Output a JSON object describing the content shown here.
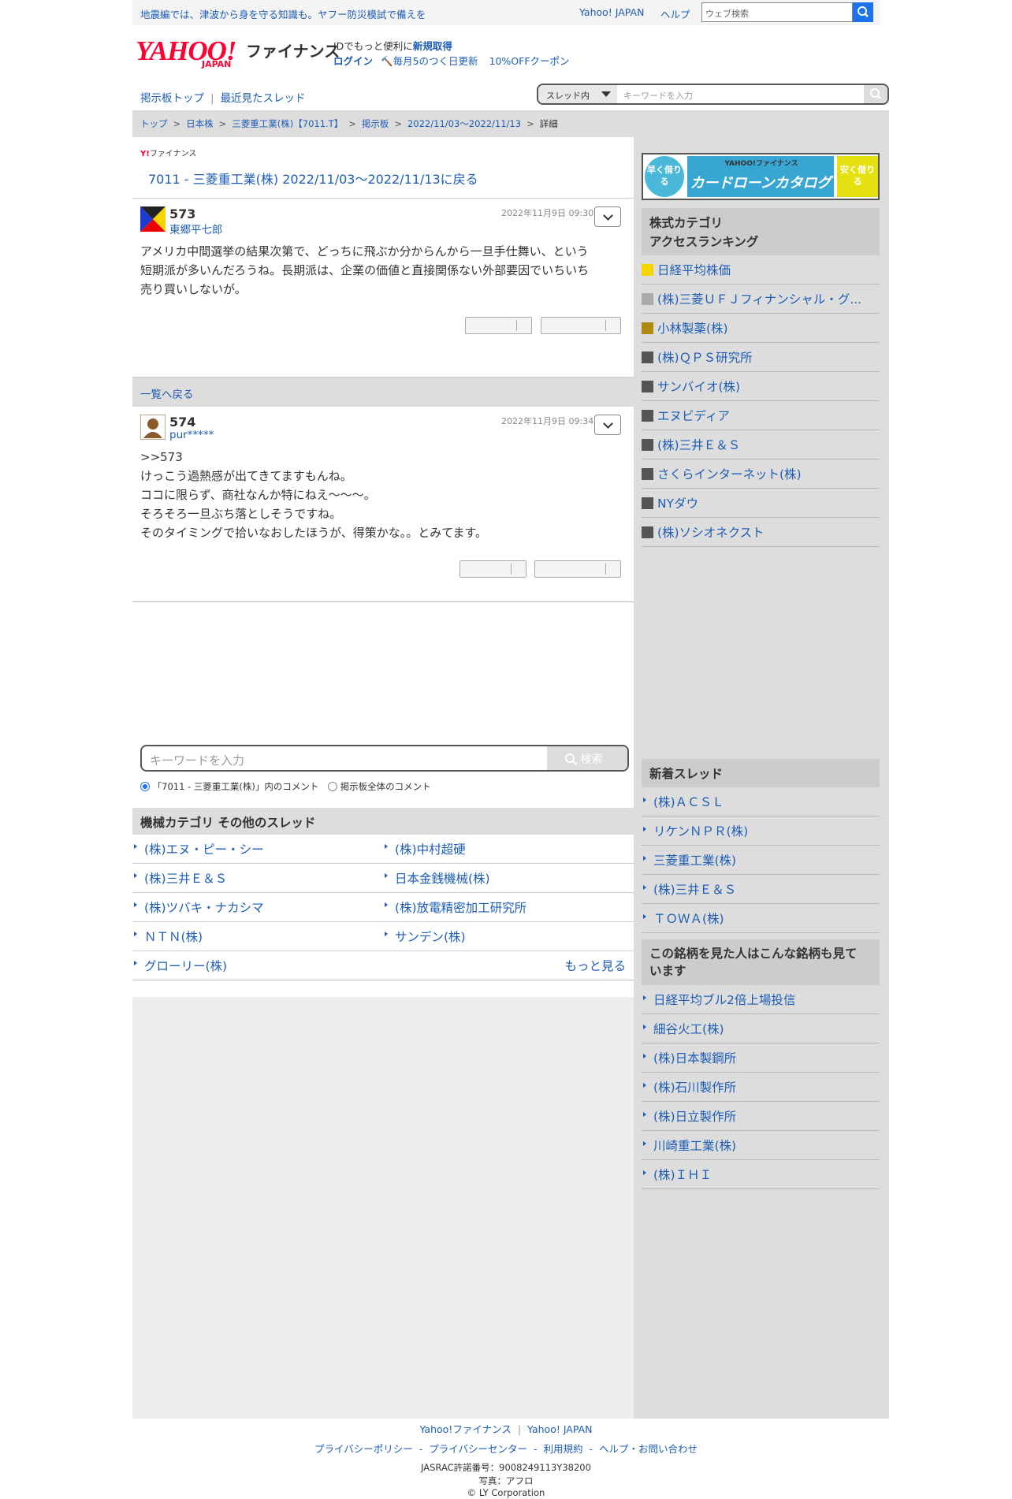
{
  "top": {
    "promo": "地震編では、津波から身を守る知識も。ヤフー防災模試で備えを",
    "link1": "Yahoo! JAPAN",
    "link2": "ヘルプ",
    "search_placeholder": "ウェブ検索"
  },
  "header": {
    "logo": "YAHOO!",
    "logo_sub": "JAPAN",
    "service": "ファイナンス",
    "line1_prefix": "IDでもっと便利に",
    "line1_link": "新規取得",
    "login": "ログイン",
    "promo1": "毎月5のつく日更新",
    "promo2": "10%OFFクーポン"
  },
  "nav": {
    "board_top": "掲示板トップ",
    "recent": "最近見たスレッド",
    "scope": "スレッド内",
    "placeholder": "キーワードを入力"
  },
  "breadcrumb": [
    "トップ",
    "日本株",
    "三菱重工業(株)【7011.T】",
    "掲示板",
    "2022/11/03〜2022/11/13",
    "詳細"
  ],
  "thread": {
    "small_logo": "ファイナンス",
    "back_title": "7011 - 三菱重工業(株) 2022/11/03〜2022/11/13に戻る",
    "list_back": "一覧へ戻る"
  },
  "posts": [
    {
      "num": "573",
      "user": "東郷平七郎",
      "date": "2022年11月9日 09:30",
      "lines": [
        "アメリカ中間選挙の結果次第で、どっちに飛ぶか分からんから一旦手仕舞い、という",
        "短期派が多いんだろうね。長期派は、企業の価値と直接関係ない外部要因でいちいち",
        "売り買いしないが。"
      ]
    },
    {
      "num": "574",
      "user": "pur*****",
      "date": "2022年11月9日 09:34",
      "lines": [
        ">>573",
        "けっこう過熱感が出てきてますもんね。",
        "ココに限らず、商社なんか特にねえ〜〜〜。",
        "そろそろ一旦ぶち落としそうですね。",
        "そのタイミングで拾いなおしたほうが、得策かな。。とみてます。"
      ]
    }
  ],
  "search": {
    "placeholder": "キーワードを入力",
    "button": "検索",
    "radio1": "「7011 - 三菱重工業(株)」内のコメント",
    "radio2": "掲示板全体のコメント"
  },
  "other": {
    "heading": "機械カテゴリ その他のスレッド",
    "items": [
      "(株)エヌ・ピー・シー",
      "(株)中村超硬",
      "(株)三井Ｅ＆Ｓ",
      "日本金銭機械(株)",
      "(株)ツバキ・ナカシマ",
      "(株)放電精密加工研究所",
      "ＮＴＮ(株)",
      "サンデン(株)",
      "グローリー(株)"
    ],
    "more": "もっと見る"
  },
  "ad": {
    "text": "カードローンカタログ",
    "left": "早く借りる",
    "right": "安く借りる",
    "brand": "YAHOO!ファイナンス"
  },
  "ranking": {
    "heading1": "株式カテゴリ",
    "heading2": "アクセスランキング",
    "items": [
      {
        "name": "日経平均株価",
        "color": "#f5d400"
      },
      {
        "name": "(株)三菱ＵＦＪフィナンシャル・グ...",
        "color": "#aaaaaa"
      },
      {
        "name": "小林製薬(株)",
        "color": "#b08a10"
      },
      {
        "name": "(株)ＱＰＳ研究所",
        "color": "#555555"
      },
      {
        "name": "サンバイオ(株)",
        "color": "#555555"
      },
      {
        "name": "エヌビディア",
        "color": "#555555"
      },
      {
        "name": "(株)三井Ｅ＆Ｓ",
        "color": "#555555"
      },
      {
        "name": "さくらインターネット(株)",
        "color": "#555555"
      },
      {
        "name": "NYダウ",
        "color": "#555555"
      },
      {
        "name": "(株)ソシオネクスト",
        "color": "#555555"
      }
    ]
  },
  "new_threads": {
    "heading": "新着スレッド",
    "items": [
      "(株)ＡＣＳＬ",
      "リケンＮＰＲ(株)",
      "三菱重工業(株)",
      "(株)三井Ｅ＆Ｓ",
      "ＴＯＷＡ(株)"
    ]
  },
  "also_viewed": {
    "heading1": "この銘柄を見た人はこんな銘柄も見て",
    "heading2": "います",
    "items": [
      "日経平均ブル2倍上場投信",
      "細谷火工(株)",
      "(株)日本製鋼所",
      "(株)石川製作所",
      "(株)日立製作所",
      "川崎重工業(株)",
      "(株)ＩＨＩ"
    ]
  },
  "footer": {
    "l1": "Yahoo!ファイナンス",
    "l2": "Yahoo! JAPAN",
    "links": [
      "プライバシーポリシー",
      "プライバシーセンター",
      "利用規約",
      "ヘルプ・お問い合わせ"
    ],
    "jasrac": "JASRAC許諾番号：9008249113Y38200",
    "photo": "写真：アフロ",
    "copy": "© LY Corporation"
  }
}
